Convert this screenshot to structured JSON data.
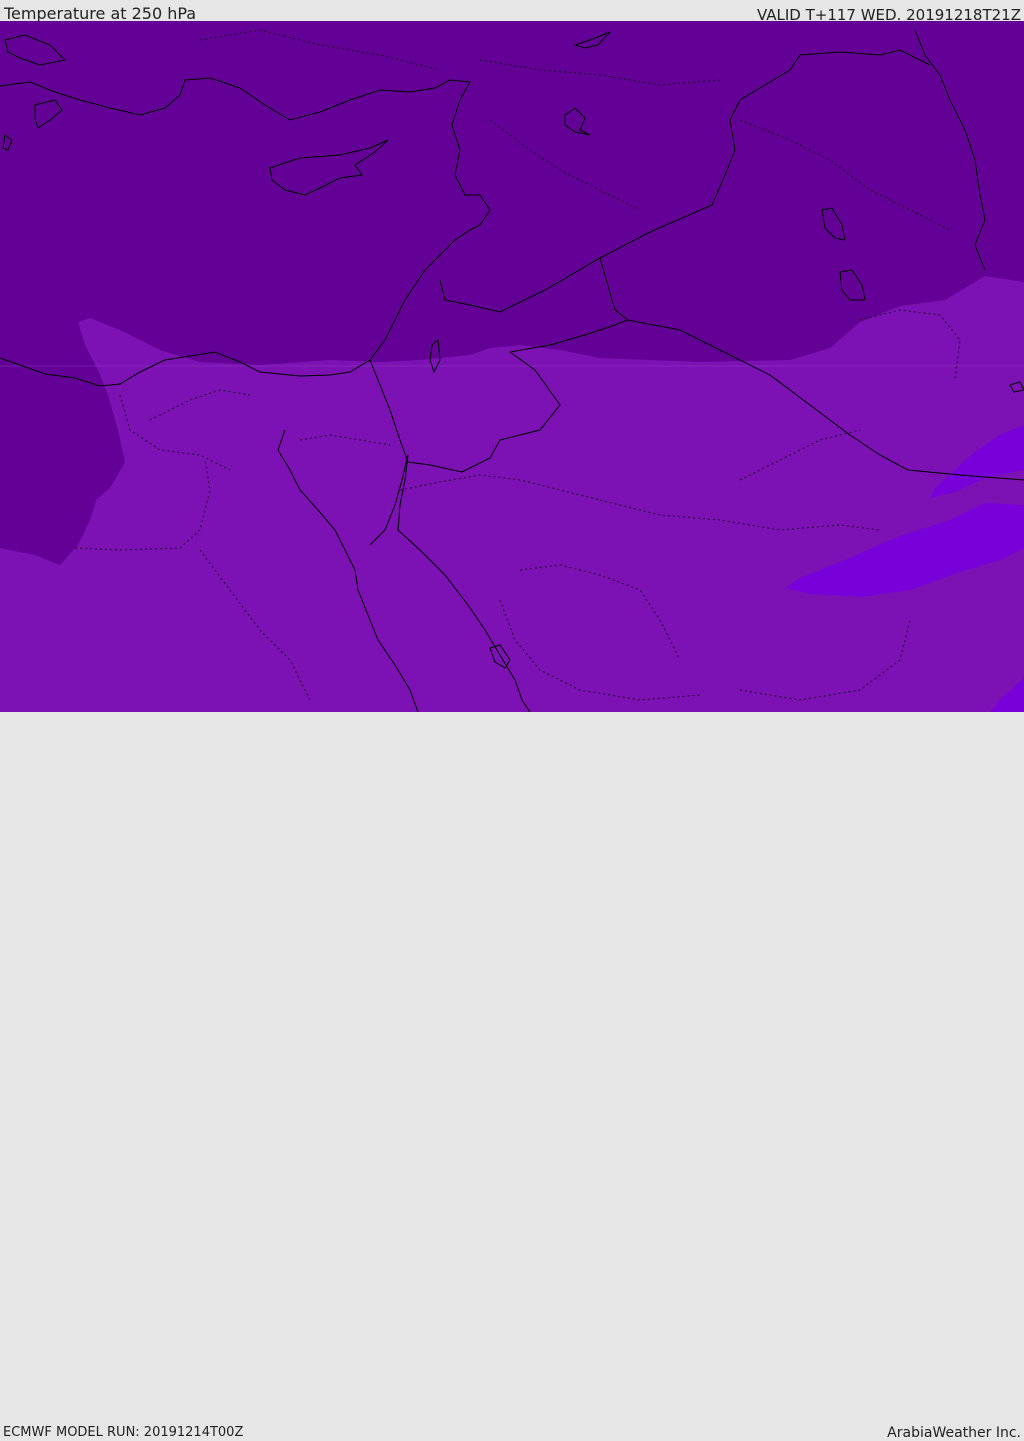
{
  "header": {
    "title": "Temperature at 250 hPa",
    "valid": "VALID T+117 WED. 20191218T21Z"
  },
  "footer": {
    "model_run": "ECMWF MODEL RUN: 20191214T00Z",
    "credit": "ArabiaWeather Inc."
  },
  "map": {
    "colors": {
      "cold_band": "#630096",
      "mid_band": "#7c12b4",
      "warm_band": "#7800d8",
      "boundary": "#000000"
    }
  }
}
